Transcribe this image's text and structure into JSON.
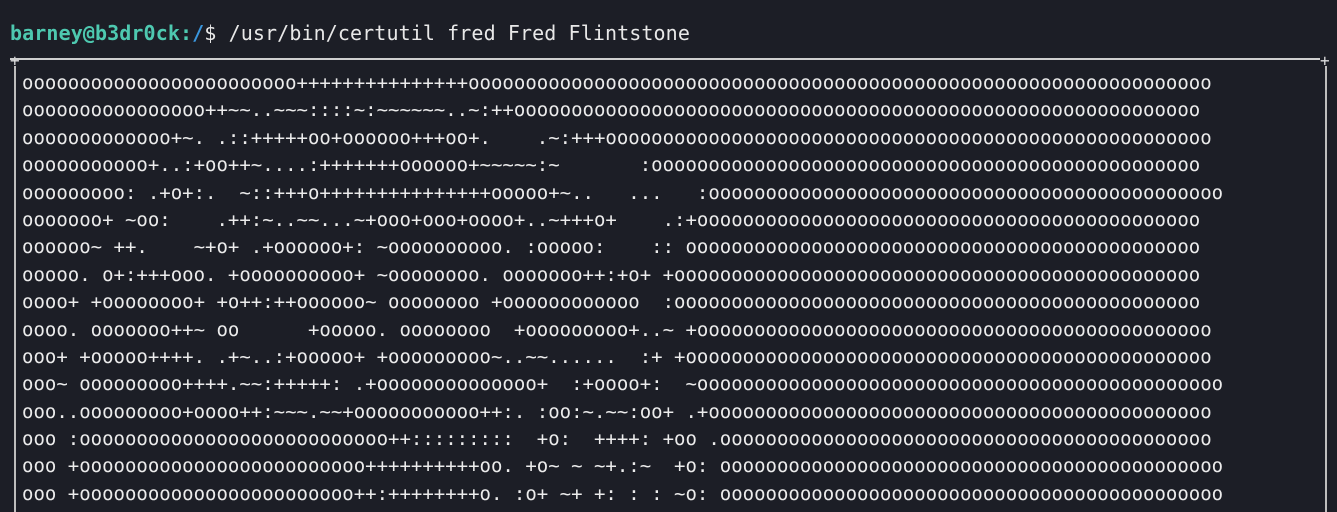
{
  "prompt": {
    "user_host": "barney@b3dr0ck",
    "separator": ":",
    "path": "/",
    "symbol": "$",
    "command": "/usr/bin/certutil fred Fred Flintstone"
  },
  "art": {
    "corner_glyph": "+",
    "rows": [
      "oooooooooooooooooooooooo+++++++++++++++ooooooooooooooooooooooooooooooooooooooooooooooooooooooooooooooooo",
      "oooooooooooooooo++~~..~~~::::~:~~~~~~..~:++oooooooooooooooooooooooooooooooooooooooooooooooooooooooooooo",
      "ooooooooooooo+~. .::+++++oo+oooooo+++oo+.    .~:+++ooooooooooooooooooooooooooooooooooooooooooooooooooooo",
      "ooooooooooo+..:+oo++~....:+++++++oooooo+~~~~~:~       :oooooooooooooooooooooooooooooooooooooooooooooooo",
      "ooooooooo: .+o+:.  ~::+++o+++++++++++++++ooooo+~..   ...   :ooooooooooooooooooooooooooooooooooooooooooooo",
      "ooooooo+ ~oo:    .++:~..~~...~+ooo+ooo+oooo+..~+++o+    .:+oooooooooooooooooooooooooooooooooooooooooooo",
      "oooooo~ ++.    ~+o+ .+oooooo+: ~oooooooooo. :ooooo:    :: ooooooooooooooooooooooooooooooooooooooooooooo",
      "ooooo. o+:+++ooo. +oooooooooo+ ~oooooooo. ooooooo++:+o+ +oooooooooooooooooooooooooooooooooooooooooooooo",
      "oooo+ +oooooooo+ +o++:++oooooo~ oooooooo +oooooooooooo  :oooooooooooooooooooooooooooooooooooooooooooooo",
      "oooo. ooooooo++~ oo      +ooooo. oooooooo  +ooooooooo+..~ +ooooooooooooooooooooooooooooooooooooooooooooo",
      "ooo+ +ooooo++++. .+~..:+ooooo+ +ooooooooo~..~~......  :+ +oooooooooooooooooooooooooooooooooooooooooooooo",
      "ooo~ ooooooooo++++.~~:+++++: .+oooooooooooooo+  :+oooo+:  ~oooooooooooooooooooooooooooooooooooooooooooooo",
      "ooo..ooooooooo+oooo++:~~~.~~+ooooooooooo++:. :oo:~.~~:oo+ .+oooooooooooooooooooooooooooooooooooooooooooo",
      "ooo :ooooooooooooooooooooooooooo++:::::::::  +o:  ++++: +oo .ooooooooooooooooooooooooooooooooooooooooooo",
      "ooo +ooooooooooooooooooooooooo++++++++++oo. +o~ ~ ~+.:~  +o: oooooooooooooooooooooooooooooooooooooooooooo",
      "ooo +oooooooooooooooooooooooo++:++++++++o. :o+ ~+ +: : : ~o: oooooooooooooooooooooooooooooooooooooooooooo"
    ]
  },
  "colors": {
    "background": "#1c1e26",
    "user_host": "#4ec9b0",
    "path": "#3a96dd",
    "text": "#e8e8e8"
  }
}
